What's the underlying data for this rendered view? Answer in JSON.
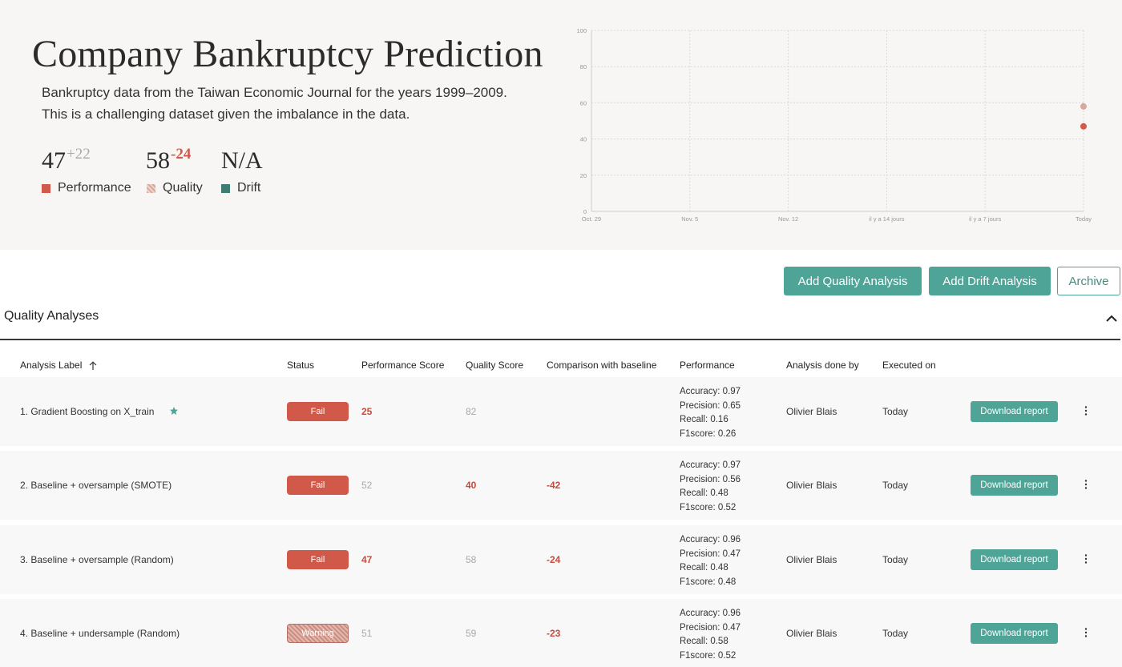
{
  "header": {
    "title": "Company Bankruptcy Prediction",
    "description_line1": "Bankruptcy data from the Taiwan Economic Journal for the years 1999–2009.",
    "description_line2": "This is a challenging dataset given the imbalance in the data."
  },
  "stats": {
    "performance": {
      "value": "47",
      "delta": "+22"
    },
    "quality": {
      "value": "58",
      "delta": "-24"
    },
    "drift": {
      "value": "N/A"
    }
  },
  "legend": {
    "performance": "Performance",
    "quality": "Quality",
    "drift": "Drift"
  },
  "colors": {
    "performance": "#d0594a",
    "quality": "#d8a89c",
    "drift": "#3f7d72",
    "accent": "#4ea597"
  },
  "chart_data": {
    "type": "scatter",
    "x_ticks": [
      "Oct. 29",
      "Nov. 5",
      "Nov. 12",
      "il y a 14 jours",
      "il y a 7 jours",
      "Today"
    ],
    "y_ticks": [
      0,
      20,
      40,
      60,
      80,
      100
    ],
    "ylim": [
      0,
      100
    ],
    "grid": true,
    "series": [
      {
        "name": "Performance",
        "x": [
          "Today"
        ],
        "values": [
          47
        ]
      },
      {
        "name": "Quality",
        "x": [
          "Today"
        ],
        "values": [
          58
        ]
      }
    ]
  },
  "actions": {
    "add_quality": "Add Quality Analysis",
    "add_drift": "Add Drift Analysis",
    "archive": "Archive"
  },
  "section": {
    "title": "Quality Analyses"
  },
  "table": {
    "columns": {
      "label": "Analysis Label",
      "status": "Status",
      "performance_score": "Performance Score",
      "quality_score": "Quality Score",
      "comparison": "Comparison with baseline",
      "performance": "Performance",
      "done_by": "Analysis done by",
      "executed_on": "Executed on"
    },
    "rows": [
      {
        "label": "1. Gradient Boosting on X_train",
        "starred": true,
        "status": "Fail",
        "status_kind": "fail",
        "performance_score": "25",
        "quality_score": "82",
        "comparison": "",
        "accuracy": "Accuracy: 0.97",
        "precision": "Precision: 0.65",
        "recall": "Recall: 0.16",
        "f1": "F1score: 0.26",
        "done_by": "Olivier Blais",
        "executed_on": "Today",
        "download": "Download report"
      },
      {
        "label": "2. Baseline + oversample (SMOTE)",
        "starred": false,
        "status": "Fail",
        "status_kind": "fail",
        "performance_score": "52",
        "quality_score": "40",
        "comparison": "-42",
        "accuracy": "Accuracy: 0.97",
        "precision": "Precision: 0.56",
        "recall": "Recall: 0.48",
        "f1": "F1score: 0.52",
        "done_by": "Olivier Blais",
        "executed_on": "Today",
        "download": "Download report"
      },
      {
        "label": "3. Baseline + oversample (Random)",
        "starred": false,
        "status": "Fail",
        "status_kind": "fail",
        "performance_score": "47",
        "quality_score": "58",
        "comparison": "-24",
        "accuracy": "Accuracy: 0.96",
        "precision": "Precision: 0.47",
        "recall": "Recall: 0.48",
        "f1": "F1score: 0.48",
        "done_by": "Olivier Blais",
        "executed_on": "Today",
        "download": "Download report"
      },
      {
        "label": "4. Baseline + undersample (Random)",
        "starred": false,
        "status": "Warning",
        "status_kind": "warning",
        "performance_score": "51",
        "quality_score": "59",
        "comparison": "-23",
        "accuracy": "Accuracy: 0.96",
        "precision": "Precision: 0.47",
        "recall": "Recall: 0.58",
        "f1": "F1score: 0.52",
        "done_by": "Olivier Blais",
        "executed_on": "Today",
        "download": "Download report"
      }
    ]
  }
}
